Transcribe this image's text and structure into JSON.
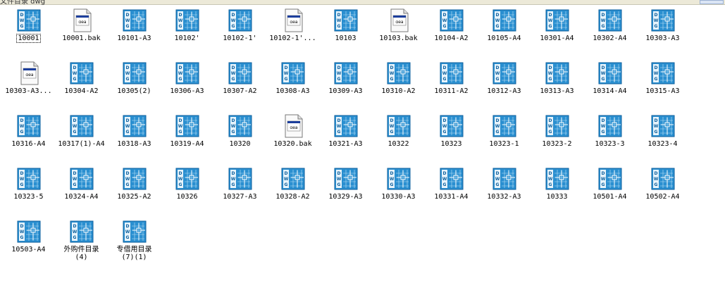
{
  "window": {
    "title": "文件目录 dwg"
  },
  "items": [
    {
      "label": "10001",
      "type": "dwg",
      "selected": true
    },
    {
      "label": "10001.bak",
      "type": "bak"
    },
    {
      "label": "10101-A3",
      "type": "dwg"
    },
    {
      "label": "10102'",
      "type": "dwg"
    },
    {
      "label": "10102-1'",
      "type": "dwg"
    },
    {
      "label": "10102-1'...",
      "type": "bak"
    },
    {
      "label": "10103",
      "type": "dwg"
    },
    {
      "label": "10103.bak",
      "type": "bak"
    },
    {
      "label": "10104-A2",
      "type": "dwg"
    },
    {
      "label": "10105-A4",
      "type": "dwg"
    },
    {
      "label": "10301-A4",
      "type": "dwg"
    },
    {
      "label": "10302-A4",
      "type": "dwg"
    },
    {
      "label": "10303-A3",
      "type": "dwg"
    },
    {
      "label": "10303-A3...",
      "type": "bak"
    },
    {
      "label": "10304-A2",
      "type": "dwg"
    },
    {
      "label": "10305(2)",
      "type": "dwg"
    },
    {
      "label": "10306-A3",
      "type": "dwg"
    },
    {
      "label": "10307-A2",
      "type": "dwg"
    },
    {
      "label": "10308-A3",
      "type": "dwg"
    },
    {
      "label": "10309-A3",
      "type": "dwg"
    },
    {
      "label": "10310-A2",
      "type": "dwg"
    },
    {
      "label": "10311-A2",
      "type": "dwg"
    },
    {
      "label": "10312-A3",
      "type": "dwg"
    },
    {
      "label": "10313-A3",
      "type": "dwg"
    },
    {
      "label": "10314-A4",
      "type": "dwg"
    },
    {
      "label": "10315-A3",
      "type": "dwg"
    },
    {
      "label": "10316-A4",
      "type": "dwg"
    },
    {
      "label": "10317(1)-A4",
      "type": "dwg"
    },
    {
      "label": "10318-A3",
      "type": "dwg"
    },
    {
      "label": "10319-A4",
      "type": "dwg"
    },
    {
      "label": "10320",
      "type": "dwg"
    },
    {
      "label": "10320.bak",
      "type": "bak"
    },
    {
      "label": "10321-A3",
      "type": "dwg"
    },
    {
      "label": "10322",
      "type": "dwg"
    },
    {
      "label": "10323",
      "type": "dwg"
    },
    {
      "label": "10323-1",
      "type": "dwg"
    },
    {
      "label": "10323-2",
      "type": "dwg"
    },
    {
      "label": "10323-3",
      "type": "dwg"
    },
    {
      "label": "10323-4",
      "type": "dwg"
    },
    {
      "label": "10323-5",
      "type": "dwg"
    },
    {
      "label": "10324-A4",
      "type": "dwg"
    },
    {
      "label": "10325-A2",
      "type": "dwg"
    },
    {
      "label": "10326",
      "type": "dwg"
    },
    {
      "label": "10327-A3",
      "type": "dwg"
    },
    {
      "label": "10328-A2",
      "type": "dwg"
    },
    {
      "label": "10329-A3",
      "type": "dwg"
    },
    {
      "label": "10330-A3",
      "type": "dwg"
    },
    {
      "label": "10331-A4",
      "type": "dwg"
    },
    {
      "label": "10332-A3",
      "type": "dwg"
    },
    {
      "label": "10333",
      "type": "dwg"
    },
    {
      "label": "10501-A4",
      "type": "dwg"
    },
    {
      "label": "10502-A4",
      "type": "dwg"
    },
    {
      "label": "10503-A4",
      "type": "dwg"
    },
    {
      "label": "外购件目录\n(4)",
      "type": "dwg"
    },
    {
      "label": "专借用目录\n(7)(1)",
      "type": "dwg"
    }
  ],
  "colors": {
    "dwg_blue": "#2a8fd0",
    "dwg_dark": "#0d5f9c",
    "bak_border": "#7a7a7a"
  }
}
